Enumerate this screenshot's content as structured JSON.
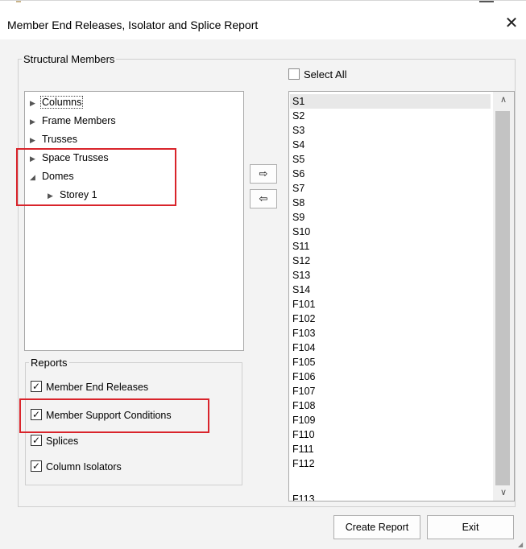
{
  "window": {
    "title": "Member End Releases, Isolator and Splice Report",
    "close_glyph": "✕"
  },
  "structural_members": {
    "legend": "Structural Members",
    "tree": [
      {
        "label": "Columns",
        "arrow": "▶"
      },
      {
        "label": "Frame Members",
        "arrow": "▶"
      },
      {
        "label": "Trusses",
        "arrow": "▶"
      },
      {
        "label": "Space Trusses",
        "arrow": "▶"
      },
      {
        "label": "Domes",
        "arrow": "◢"
      },
      {
        "label": "Storey 1",
        "arrow": "▶"
      }
    ],
    "move_right_glyph": "⇨",
    "move_left_glyph": "⇦",
    "select_all": {
      "label": "Select All",
      "checked": false
    },
    "list": [
      "S1",
      "S2",
      "S3",
      "S4",
      "S5",
      "S6",
      "S7",
      "S8",
      "S9",
      "S10",
      "S11",
      "S12",
      "S13",
      "S14",
      "F101",
      "F102",
      "F103",
      "F104",
      "F105",
      "F106",
      "F107",
      "F108",
      "F109",
      "F110",
      "F111",
      "F112",
      "F113"
    ],
    "scroll_up_glyph": "∧",
    "scroll_down_glyph": "∨"
  },
  "reports": {
    "legend": "Reports",
    "items": [
      {
        "label": "Member End Releases",
        "checked": true
      },
      {
        "label": "Member Support Conditions",
        "checked": true
      },
      {
        "label": "Splices",
        "checked": true
      },
      {
        "label": "Column Isolators",
        "checked": true
      }
    ]
  },
  "buttons": {
    "create_report": "Create Report",
    "exit": "Exit"
  },
  "colors": {
    "highlight": "#d9242b",
    "selection": "#e8e8e8"
  }
}
